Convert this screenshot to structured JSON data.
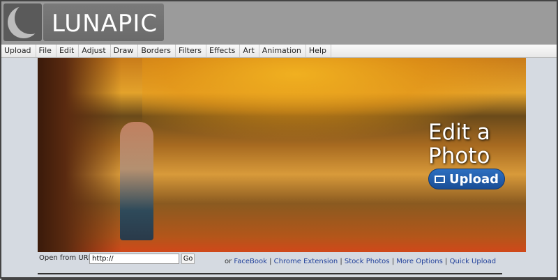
{
  "logo": {
    "text": "LUNAPIC"
  },
  "menu": [
    "Upload",
    "File",
    "Edit",
    "Adjust",
    "Draw",
    "Borders",
    "Filters",
    "Effects",
    "Art",
    "Animation",
    "Help"
  ],
  "hero": {
    "title_line1": "Edit a",
    "title_line2": "Photo",
    "upload_label": "Upload"
  },
  "url": {
    "label": "Open from URL:",
    "value": "http://",
    "go": "Go"
  },
  "links": {
    "prefix": "or",
    "items": [
      "FaceBook",
      "Chrome Extension",
      "Stock Photos",
      "More Options",
      "Quick Upload"
    ],
    "separator": "|"
  }
}
